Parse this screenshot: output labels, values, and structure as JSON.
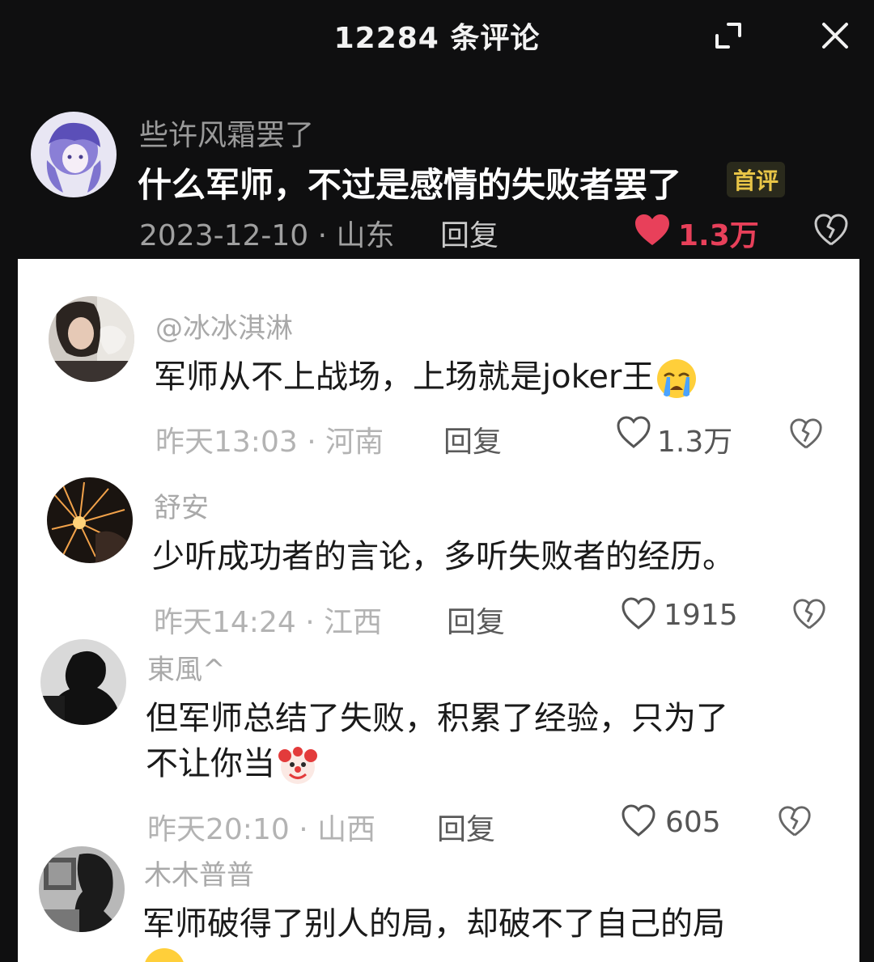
{
  "header": {
    "title": "12284 条评论"
  },
  "top_comment": {
    "username": "些许风霜罢了",
    "text": "什么军师，不过是感情的失败者罢了",
    "badge": "首评",
    "meta": "2023-12-10 · 山东",
    "reply_label": "回复",
    "likes": "1.3万",
    "liked": true
  },
  "comments": [
    {
      "username": "@冰冰淇淋",
      "text": "军师从不上战场，上场就是joker王",
      "emoji": "crying-face",
      "meta": "昨天13:03  ·  河南",
      "reply_label": "回复",
      "likes": "1.3万"
    },
    {
      "username": "舒安",
      "text": "少听成功者的言论，多听失败者的经历。",
      "meta": "昨天14:24  ·  江西",
      "reply_label": "回复",
      "likes": "1915"
    },
    {
      "username": "東風^",
      "text_line1": "但军师总结了失败，积累了经验，只为了",
      "text_line2": "不让你当",
      "emoji": "clown-face",
      "meta": "昨天20:10  ·  山西",
      "reply_label": "回复",
      "likes": "605"
    },
    {
      "username": "木木普普",
      "text": "军师破得了别人的局，却破不了自己的局"
    }
  ],
  "colors": {
    "dark_bg": "#0f0f10",
    "like_red": "#e8405a",
    "badge_gold": "#e8c547"
  }
}
